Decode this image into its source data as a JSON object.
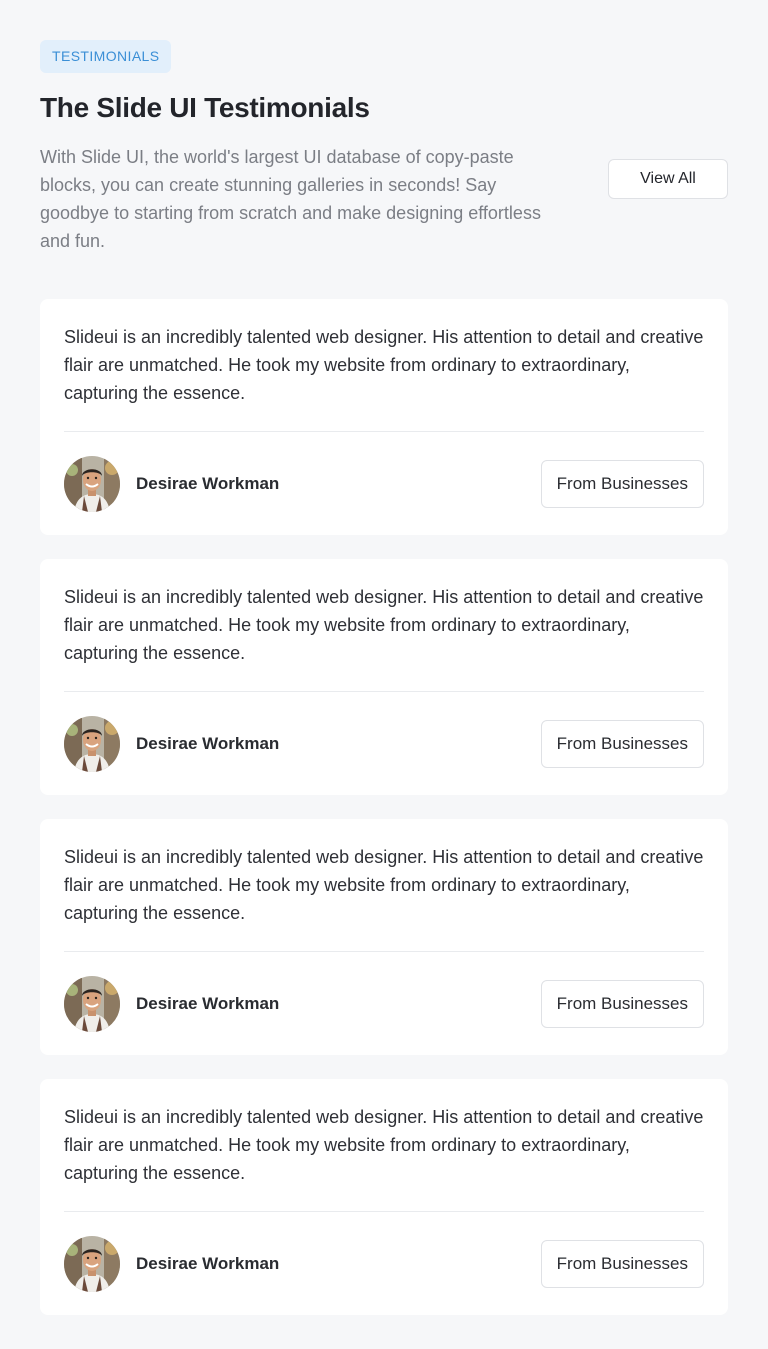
{
  "section": {
    "badge": "TESTIMONIALS",
    "title": "The Slide UI Testimonials",
    "description": "With Slide UI, the world's largest UI database of copy-paste blocks, you can create stunning galleries in seconds! Say goodbye to starting from scratch and make designing effortless and fun.",
    "view_all_label": "View All"
  },
  "colors": {
    "background": "#f6f7f9",
    "card": "#ffffff",
    "badge_bg": "#e2effb",
    "badge_text": "#3b8fd6",
    "muted_text": "#7b7e85"
  },
  "testimonials": [
    {
      "quote": "Slideui is an incredibly talented web designer. His attention to detail and creative flair are unmatched. He took my website from ordinary to extraordinary, capturing the essence.",
      "name": "Desirae Workman",
      "tag": "From Businesses",
      "avatar": "avatar-photo"
    },
    {
      "quote": "Slideui is an incredibly talented web designer. His attention to detail and creative flair are unmatched. He took my website from ordinary to extraordinary, capturing the essence.",
      "name": "Desirae Workman",
      "tag": "From Businesses",
      "avatar": "avatar-photo"
    },
    {
      "quote": "Slideui is an incredibly talented web designer. His attention to detail and creative flair are unmatched. He took my website from ordinary to extraordinary, capturing the essence.",
      "name": "Desirae Workman",
      "tag": "From Businesses",
      "avatar": "avatar-photo"
    },
    {
      "quote": "Slideui is an incredibly talented web designer. His attention to detail and creative flair are unmatched. He took my website from ordinary to extraordinary, capturing the essence.",
      "name": "Desirae Workman",
      "tag": "From Businesses",
      "avatar": "avatar-photo"
    }
  ]
}
